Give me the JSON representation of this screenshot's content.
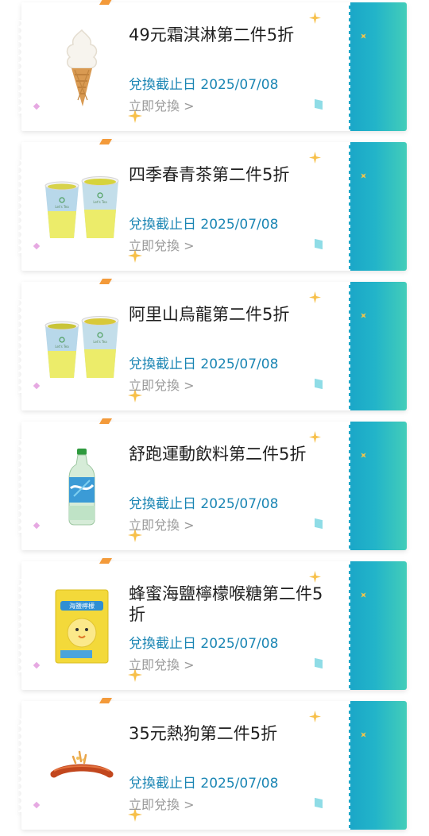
{
  "coupons": [
    {
      "title": "49元霜淇淋第二件5折",
      "deadline": "兌換截止日 2025/07/08",
      "action": "立即兌換 >",
      "product_icon": "soft-serve-ice-cream-cone"
    },
    {
      "title": "四季春青茶第二件5折",
      "deadline": "兌換截止日 2025/07/08",
      "action": "立即兌換 >",
      "product_icon": "two-tea-cups",
      "cup_label": "Let's Tea"
    },
    {
      "title": "阿里山烏龍第二件5折",
      "deadline": "兌換截止日 2025/07/08",
      "action": "立即兌換 >",
      "product_icon": "two-tea-cups",
      "cup_label": "Let's Tea"
    },
    {
      "title": "舒跑運動飲料第二件5折",
      "deadline": "兌換截止日 2025/07/08",
      "action": "立即兌換 >",
      "product_icon": "sports-drink-bottle"
    },
    {
      "title": "蜂蜜海鹽檸檬喉糖第二件5折",
      "deadline": "兌換截止日 2025/07/08",
      "action": "立即兌換 >",
      "product_icon": "candy-pack",
      "pack_label": "海鹽檸檬"
    },
    {
      "title": "35元熱狗第二件5折",
      "deadline": "兌換截止日 2025/07/08",
      "action": "立即兌換 >",
      "product_icon": "hot-dog-sausage"
    }
  ],
  "colors": {
    "stub_gradient_start": "#1aa6c8",
    "stub_gradient_end": "#43cdb9",
    "deadline_text": "#1b86b4",
    "action_text": "#9a9a9a",
    "title_text": "#1f1f1f",
    "sparkle": "#f7c04a"
  }
}
